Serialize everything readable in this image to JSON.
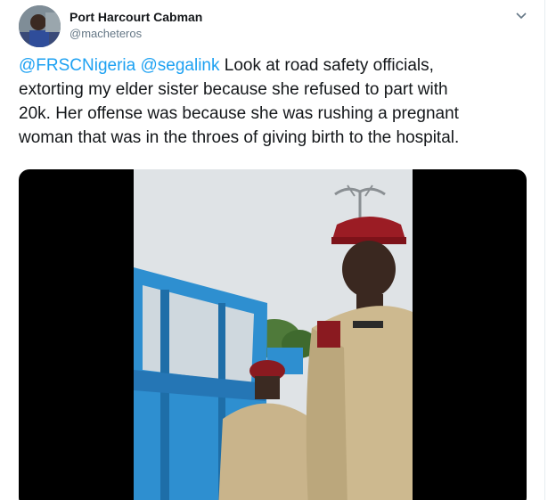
{
  "tweet": {
    "display_name": "Port Harcourt Cabman",
    "handle": "@macheteros",
    "mentions": [
      "@FRSCNigeria",
      "@segalink"
    ],
    "text_lines": [
      " Look at road safety officials,",
      "extorting my elder sister because she refused to part with",
      "20k. Her offense was because she was rushing a pregnant",
      "woman that was in the throes of giving birth to the hospital."
    ],
    "icons": {
      "more": "chevron-down-icon"
    },
    "colors": {
      "mention": "#1da1f2",
      "text": "#14171a",
      "secondary": "#657786",
      "media_background": "#000000"
    }
  }
}
